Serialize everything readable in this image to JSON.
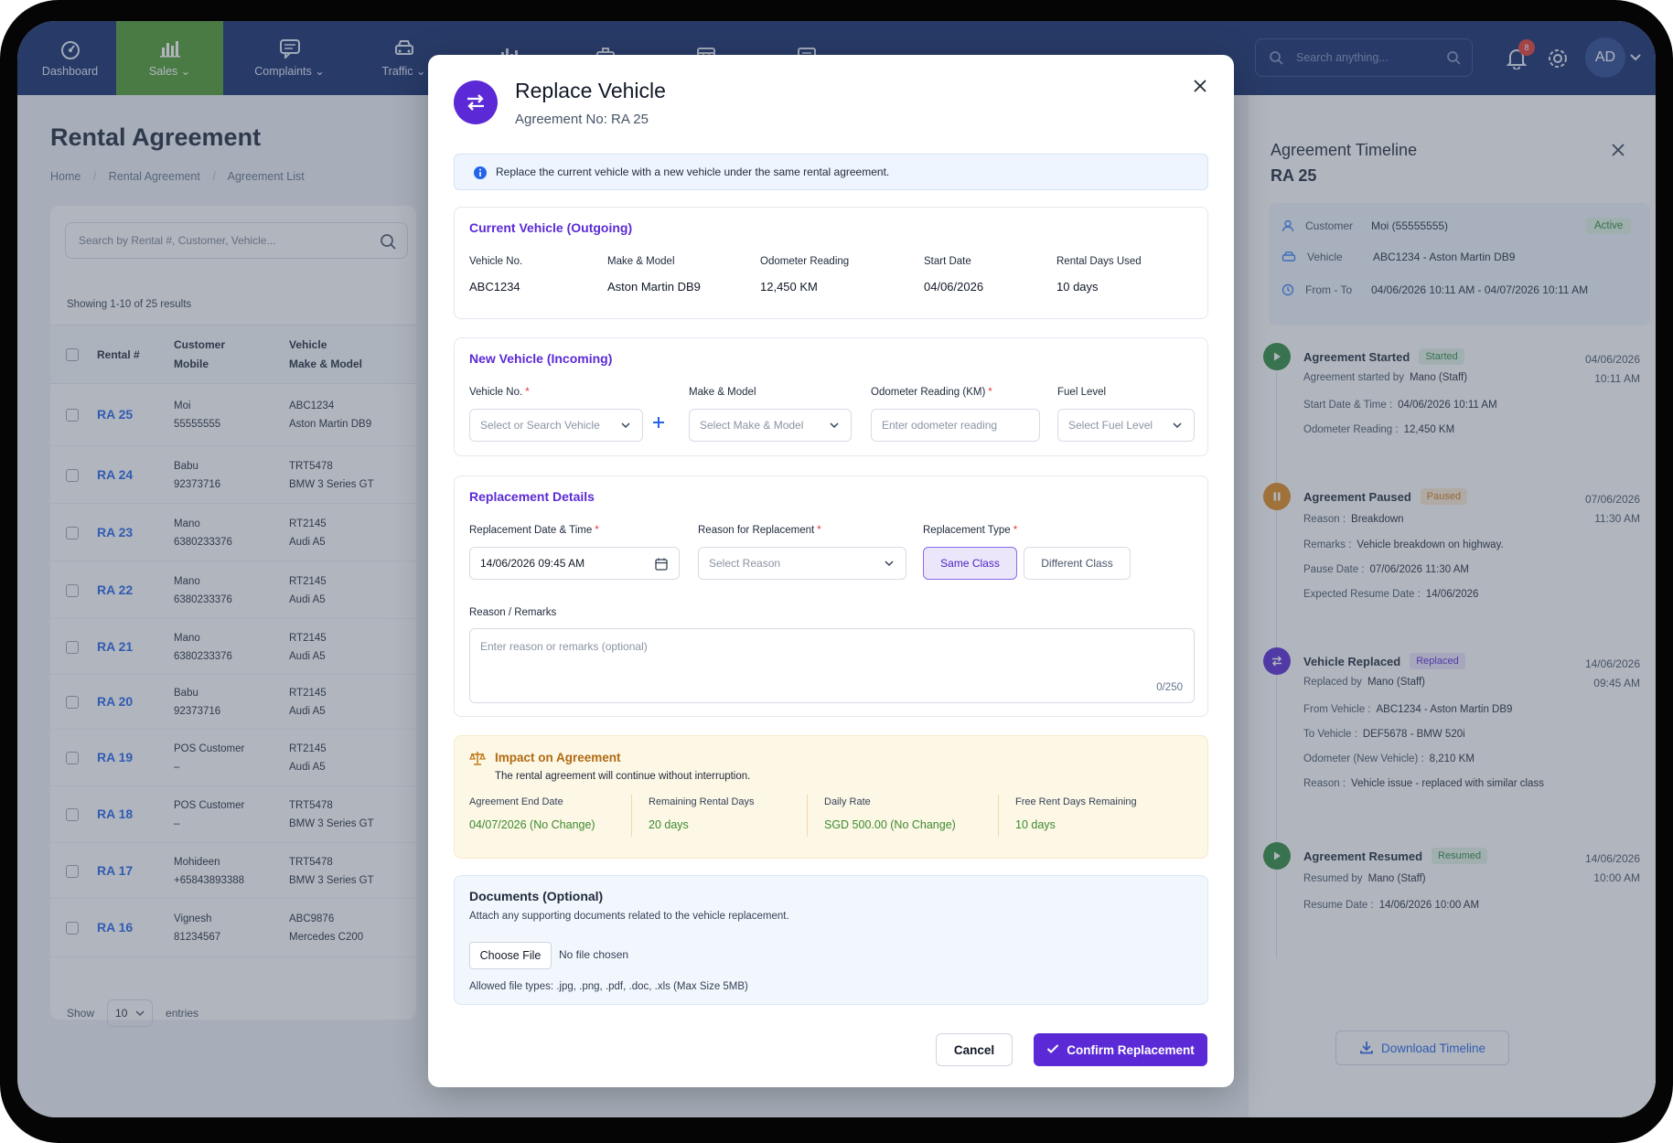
{
  "nav": {
    "items": [
      {
        "label": "Dashboard",
        "icon": "dashboard-icon"
      },
      {
        "label": "Sales ⌄",
        "icon": "bar-chart-icon"
      },
      {
        "label": "Complaints ⌄",
        "icon": "chat-icon"
      },
      {
        "label": "Traffic ⌄",
        "icon": "car-icon"
      }
    ],
    "search_placeholder": "Search anything...",
    "notification_count": "8",
    "avatar_initials": "AD",
    "active_color": "#4e9a2e"
  },
  "page": {
    "title": "Rental Agreement",
    "breadcrumb": [
      "Home",
      "/",
      "Rental Agreement",
      "/",
      "Agreement List"
    ],
    "search_placeholder": "Search by Rental #, Customer, Vehicle...",
    "showing": "Showing 1-10 of 25 results",
    "columns": {
      "rental": "Rental #",
      "customer_1": "Customer",
      "customer_2": "Mobile",
      "vehicle_1": "Vehicle",
      "vehicle_2": "Make & Model"
    },
    "rows": [
      {
        "id": "RA 25",
        "customer": "Moi",
        "mobile": "55555555",
        "vehicle": "ABC1234",
        "model": "Aston Martin DB9"
      },
      {
        "id": "RA 24",
        "customer": "Babu",
        "mobile": "92373716",
        "vehicle": "TRT5478",
        "model": "BMW 3 Series GT"
      },
      {
        "id": "RA 23",
        "customer": "Mano",
        "mobile": "6380233376",
        "vehicle": "RT2145",
        "model": "Audi A5"
      },
      {
        "id": "RA 22",
        "customer": "Mano",
        "mobile": "6380233376",
        "vehicle": "RT2145",
        "model": "Audi A5"
      },
      {
        "id": "RA 21",
        "customer": "Mano",
        "mobile": "6380233376",
        "vehicle": "RT2145",
        "model": "Audi A5"
      },
      {
        "id": "RA 20",
        "customer": "Babu",
        "mobile": "92373716",
        "vehicle": "RT2145",
        "model": "Audi A5"
      },
      {
        "id": "RA 19",
        "customer": "POS Customer",
        "mobile": "–",
        "vehicle": "RT2145",
        "model": "Audi A5"
      },
      {
        "id": "RA 18",
        "customer": "POS Customer",
        "mobile": "–",
        "vehicle": "TRT5478",
        "model": "BMW 3 Series GT"
      },
      {
        "id": "RA 17",
        "customer": "Mohideen",
        "mobile": "+65843893388",
        "vehicle": "TRT5478",
        "model": "BMW 3 Series GT"
      },
      {
        "id": "RA 16",
        "customer": "Vignesh",
        "mobile": "81234567",
        "vehicle": "ABC9876",
        "model": "Mercedes C200"
      }
    ],
    "show_label": "Show",
    "show_value": "10",
    "entries_label": "entries"
  },
  "timeline": {
    "title": "Agreement Timeline",
    "agreement_no": "RA 25",
    "status": "Active",
    "summary": [
      {
        "label": "Customer",
        "value": "Moi (55555555)",
        "icon": "user-icon"
      },
      {
        "label": "Vehicle",
        "value": "ABC1234 - Aston Martin DB9",
        "icon": "car-icon"
      },
      {
        "label": "From - To",
        "value": "04/06/2026  10:11 AM - 04/07/2026  10:11 AM",
        "icon": "clock-icon"
      }
    ],
    "events": [
      {
        "title": "Agreement Started",
        "badge": "Started",
        "date": "04/06/2026",
        "time": "10:11 AM",
        "color": "#2f8a3e",
        "lines": [
          [
            "Agreement started by",
            "Mano (Staff)"
          ],
          [
            "Start Date & Time :",
            "04/06/2026  10:11 AM"
          ],
          [
            "Odometer Reading :",
            "12,450 KM"
          ]
        ]
      },
      {
        "title": "Agreement Paused",
        "badge": "Paused",
        "date": "07/06/2026",
        "time": "11:30 AM",
        "color": "#e08a1e",
        "lines": [
          [
            "Reason :",
            "Breakdown"
          ],
          [
            "Remarks :",
            "Vehicle breakdown on highway."
          ],
          [
            "Pause Date :",
            "07/06/2026  11:30 AM"
          ],
          [
            "Expected Resume Date :",
            "14/06/2026"
          ]
        ]
      },
      {
        "title": "Vehicle Replaced",
        "badge": "Replaced",
        "date": "14/06/2026",
        "time": "09:45 AM",
        "color": "#5b2ad6",
        "lines": [
          [
            "Replaced by",
            "Mano (Staff)"
          ],
          [
            "From Vehicle :",
            "ABC1234 - Aston Martin DB9"
          ],
          [
            "To Vehicle :",
            "DEF5678 - BMW 520i"
          ],
          [
            "Odometer (New Vehicle) :",
            "8,210 KM"
          ],
          [
            "Reason :",
            "Vehicle issue - replaced with similar class"
          ]
        ]
      },
      {
        "title": "Agreement Resumed",
        "badge": "Resumed",
        "date": "14/06/2026",
        "time": "10:00 AM",
        "color": "#2f8a3e",
        "lines": [
          [
            "Resumed by",
            "Mano (Staff)"
          ],
          [
            "Resume Date :",
            "14/06/2026  10:00 AM"
          ]
        ]
      }
    ],
    "download_label": "Download Timeline"
  },
  "modal": {
    "title": "Replace Vehicle",
    "subtitle": "Agreement No:  RA 25",
    "info": "Replace the current vehicle with a new vehicle under the same rental agreement.",
    "current": {
      "title": "Current Vehicle (Outgoing)",
      "fields": [
        {
          "label": "Vehicle No.",
          "value": "ABC1234"
        },
        {
          "label": "Make & Model",
          "value": "Aston Martin DB9"
        },
        {
          "label": "Odometer Reading",
          "value": "12,450 KM"
        },
        {
          "label": "Start Date",
          "value": "04/06/2026"
        },
        {
          "label": "Rental Days Used",
          "value": "10 days"
        }
      ]
    },
    "new_vehicle": {
      "title": "New Vehicle (Incoming)",
      "vehicle_label": "Vehicle No.",
      "vehicle_placeholder": "Select or Search Vehicle",
      "make_label": "Make & Model",
      "make_placeholder": "Select Make & Model",
      "odo_label": "Odometer Reading (KM)",
      "odo_placeholder": "Enter odometer reading",
      "fuel_label": "Fuel Level",
      "fuel_placeholder": "Select Fuel Level"
    },
    "replacement": {
      "title": "Replacement Details",
      "date_label": "Replacement Date & Time",
      "date_value": "14/06/2026   09:45 AM",
      "reason_label": "Reason for Replacement",
      "reason_placeholder": "Select Reason",
      "type_label": "Replacement Type",
      "type_options": [
        "Same Class",
        "Different Class"
      ],
      "type_selected": "Same Class",
      "remarks_label": "Reason / Remarks",
      "remarks_placeholder": "Enter reason or remarks (optional)",
      "remarks_count": "0/250"
    },
    "impact": {
      "title": "Impact on Agreement",
      "subtitle": "The rental agreement will continue without interruption.",
      "items": [
        {
          "label": "Agreement End Date",
          "value": "04/07/2026 (No Change)"
        },
        {
          "label": "Remaining Rental Days",
          "value": "20 days"
        },
        {
          "label": "Daily Rate",
          "value": "SGD 500.00 (No Change)"
        },
        {
          "label": "Free Rent Days Remaining",
          "value": "10 days"
        }
      ]
    },
    "documents": {
      "title": "Documents (Optional)",
      "subtitle": "Attach any supporting documents related to the vehicle replacement.",
      "choose_label": "Choose File",
      "no_file": "No file chosen",
      "allowed": "Allowed file types: .jpg, .png, .pdf, .doc, .xls (Max Size 5MB)"
    },
    "cancel_label": "Cancel",
    "confirm_label": "Confirm Replacement",
    "accent_color": "#5b2ad6"
  }
}
